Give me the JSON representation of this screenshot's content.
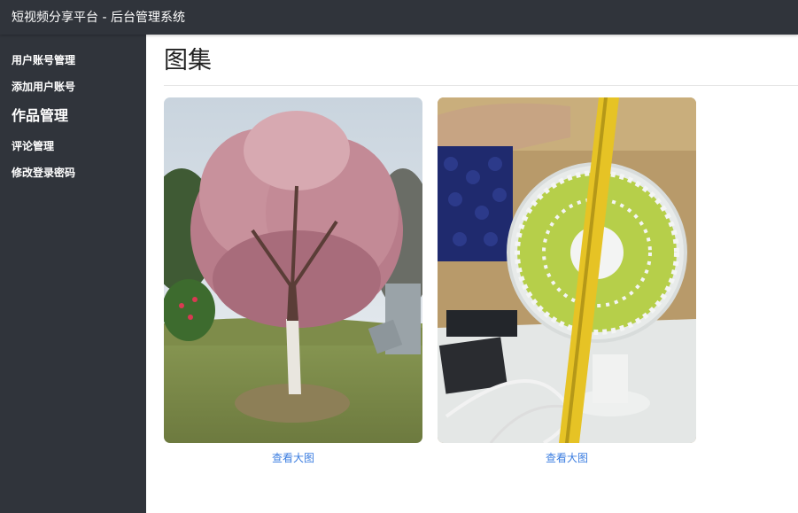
{
  "header": {
    "app_title": "短视频分享平台 - 后台管理系统"
  },
  "sidebar": {
    "items": [
      {
        "label": "用户账号管理"
      },
      {
        "label": "添加用户账号"
      },
      {
        "label": "作品管理"
      },
      {
        "label": "评论管理"
      },
      {
        "label": "修改登录密码"
      }
    ],
    "active_index": 2
  },
  "main": {
    "title": "图集",
    "gallery": [
      {
        "image_desc": "flowering-tree-photo",
        "link_label": "查看大图"
      },
      {
        "image_desc": "desk-fan-with-tape-measure-photo",
        "link_label": "查看大图"
      }
    ]
  },
  "colors": {
    "chrome": "#30343b",
    "link": "#3b7de0",
    "background": "#ffffff"
  }
}
